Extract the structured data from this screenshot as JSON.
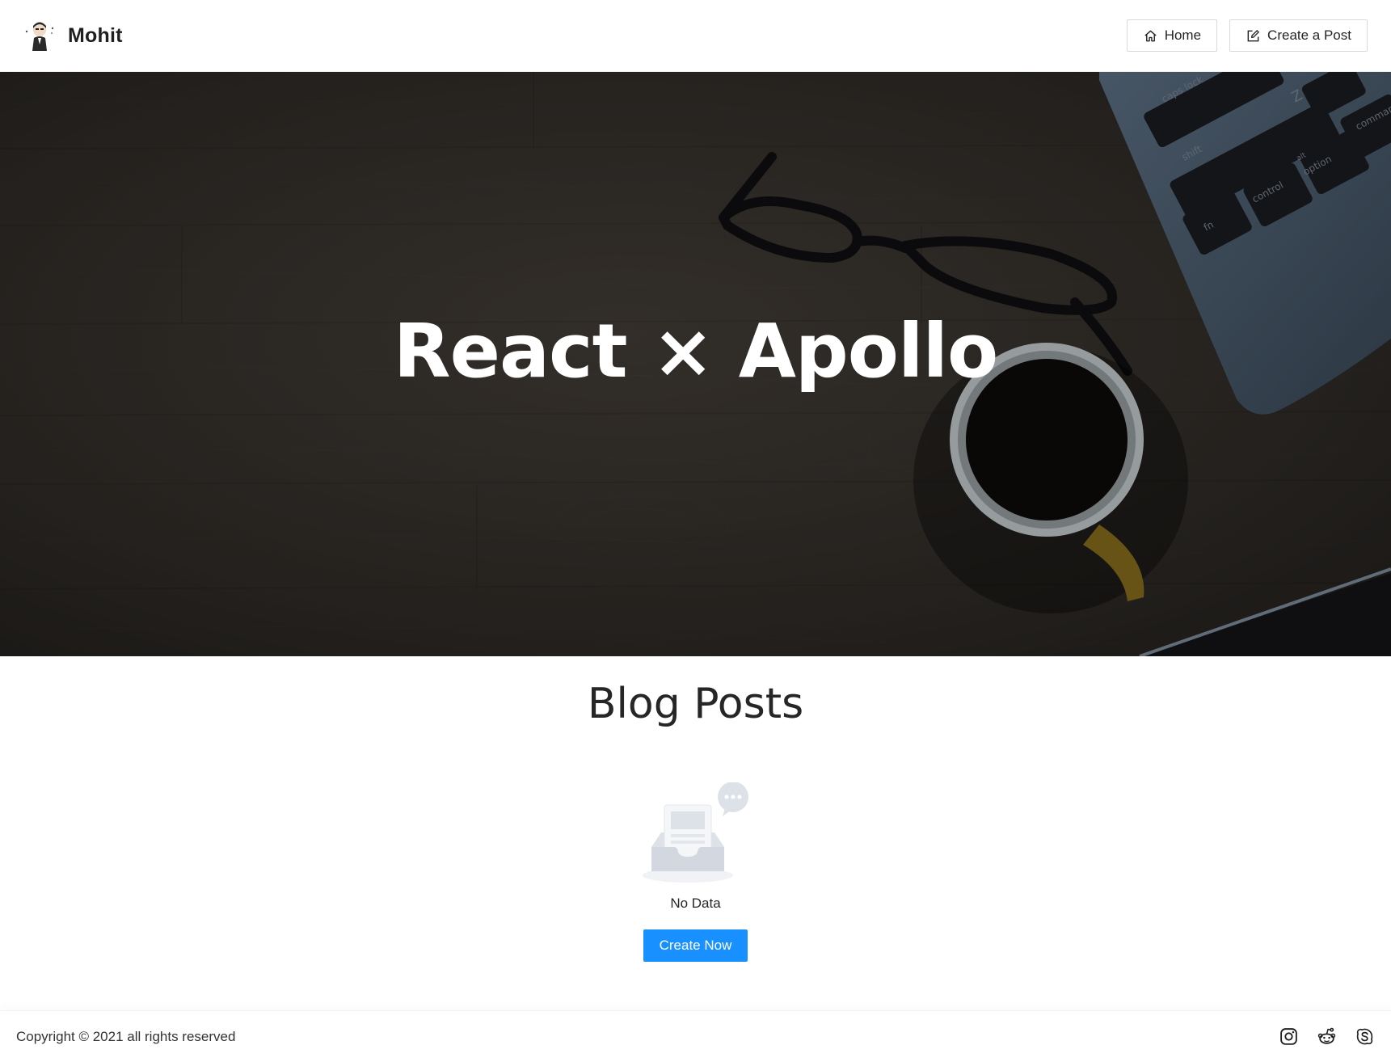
{
  "header": {
    "brand_name": "Mohit",
    "nav": [
      {
        "label": "Home",
        "icon": "home-icon"
      },
      {
        "label": "Create a Post",
        "icon": "edit-icon"
      }
    ]
  },
  "hero": {
    "title": "React × Apollo",
    "keyboard_keys": [
      "caps lock",
      "shift",
      "fn",
      "control",
      "option",
      "alt",
      "Z",
      "command"
    ]
  },
  "blog": {
    "title": "Blog Posts",
    "empty_text": "No Data",
    "create_button": "Create Now"
  },
  "footer": {
    "copyright": "Copyright © 2021 all rights reserved",
    "social_icons": [
      "instagram-icon",
      "reddit-icon",
      "skype-icon"
    ]
  },
  "colors": {
    "primary": "#1890ff",
    "hero_dark": "#2f2b27",
    "text": "#262626"
  }
}
